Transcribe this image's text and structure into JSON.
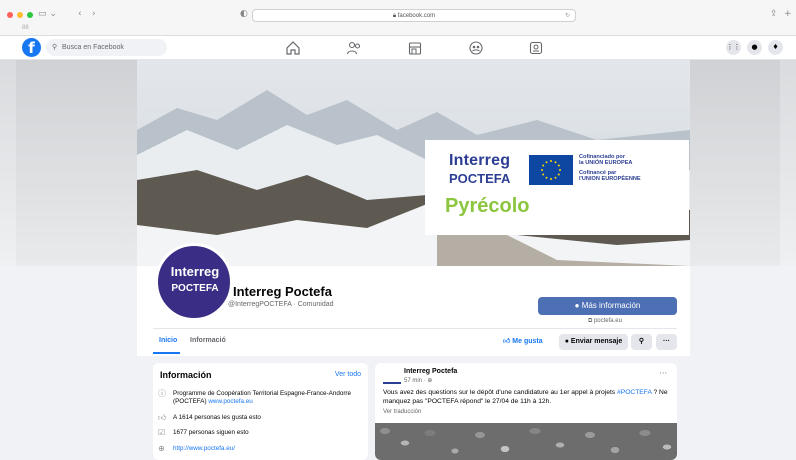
{
  "browser": {
    "url": "facebook.com",
    "sub_label": "88"
  },
  "topbar": {
    "logo": "f",
    "search_placeholder": "Busca en Facebook",
    "right_icons": [
      "grid-menu-icon",
      "messenger-icon",
      "bell-icon"
    ]
  },
  "cover": {
    "brand_line1": "Interreg",
    "brand_line2": "POCTEFA",
    "eu_line1": "Cofinanciado por",
    "eu_line2": "la UNIÓN EUROPEA",
    "eu_line3": "Cofinancé par",
    "eu_line4": "l'UNION EUROPÉENNE",
    "project": "Pyrécolo"
  },
  "profile": {
    "avatar_line1": "Interreg",
    "avatar_line2": "POCTEFA",
    "name": "Interreg Poctefa",
    "handle": "@InterregPOCTEFA · Comunidad",
    "more_info": "Más información",
    "website": "poctefa.eu"
  },
  "tabs": [
    {
      "label": "Inicio",
      "active": true
    },
    {
      "label": "Informació",
      "active": false
    }
  ],
  "actions": {
    "like": "Me gusta",
    "message": "Enviar mensaje"
  },
  "info_card": {
    "title": "Información",
    "see_all": "Ver todo",
    "description": "Programme de Coopération Territorial Espagne-France-Andorre (POCTEFA)",
    "description_link": "www.poctefa.eu",
    "likes": "A 1614 personas les gusta esto",
    "followers": "1677 personas siguen esto",
    "website": "http://www.poctefa.eu/"
  },
  "post": {
    "author": "Interreg Poctefa",
    "time": "57 min · ",
    "text_before": "Vous avez des questions sur le dépôt d'une candidature au 1er appel à projets ",
    "hashtag": "#POCTEFA",
    "text_after": " ? Ne manquez pas \"POCTEFA répond\" le 27/04 de 11h à 12h.",
    "translate": "Ver traducción"
  },
  "colors": {
    "fb_blue": "#1877f2",
    "interreg_navy": "#2b3e93",
    "pyrecolo_green": "#8cc63f",
    "avatar_purple": "#3a2d86"
  }
}
